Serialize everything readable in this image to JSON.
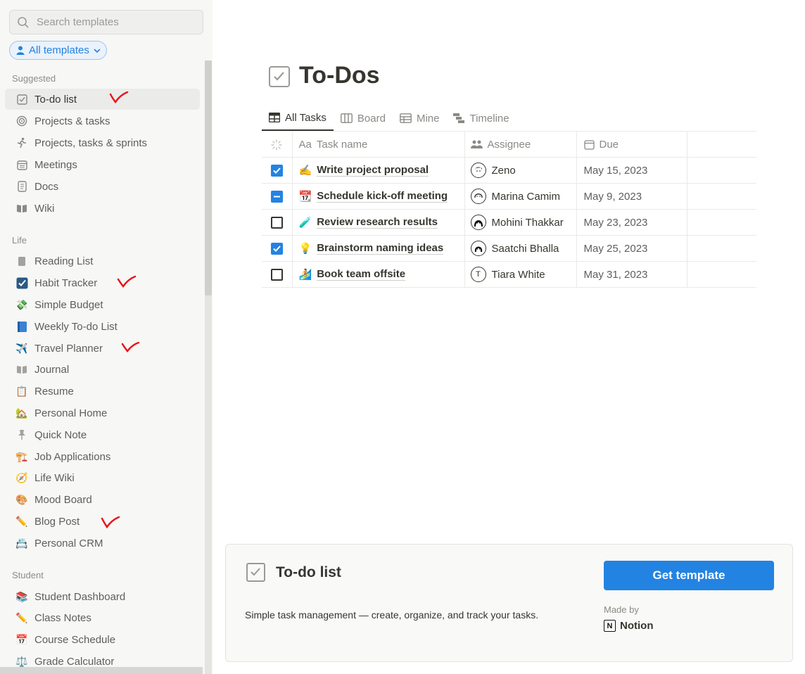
{
  "sidebar": {
    "search_placeholder": "Search templates",
    "filter_label": "All templates",
    "sections": {
      "suggested": "Suggested",
      "life": "Life",
      "student": "Student"
    },
    "suggested_items": [
      {
        "label": "To-do list",
        "icon": "checkbox-icon",
        "selected": true
      },
      {
        "label": "Projects & tasks",
        "icon": "target-icon"
      },
      {
        "label": "Projects, tasks & sprints",
        "icon": "runner-icon"
      },
      {
        "label": "Meetings",
        "icon": "calendar-icon"
      },
      {
        "label": "Docs",
        "icon": "document-icon"
      },
      {
        "label": "Wiki",
        "icon": "book-icon"
      }
    ],
    "life_items": [
      {
        "label": "Reading List",
        "icon": "bookmark-icon"
      },
      {
        "label": "Habit Tracker",
        "icon": "checked-box-icon"
      },
      {
        "label": "Simple Budget",
        "icon": "money-icon"
      },
      {
        "label": "Weekly To-do List",
        "icon": "blue-book-icon"
      },
      {
        "label": "Travel Planner",
        "icon": "airplane-icon"
      },
      {
        "label": "Journal",
        "icon": "book-icon"
      },
      {
        "label": "Resume",
        "icon": "clipboard-icon"
      },
      {
        "label": "Personal Home",
        "icon": "house-icon"
      },
      {
        "label": "Quick Note",
        "icon": "pushpin-icon"
      },
      {
        "label": "Job Applications",
        "icon": "crane-icon"
      },
      {
        "label": "Life Wiki",
        "icon": "compass-icon"
      },
      {
        "label": "Mood Board",
        "icon": "palette-icon"
      },
      {
        "label": "Blog Post",
        "icon": "pencil-icon"
      },
      {
        "label": "Personal CRM",
        "icon": "card-index-icon"
      }
    ],
    "student_items": [
      {
        "label": "Student Dashboard",
        "icon": "books-icon"
      },
      {
        "label": "Class Notes",
        "icon": "pencil-icon"
      },
      {
        "label": "Course Schedule",
        "icon": "calendar-icon"
      },
      {
        "label": "Grade Calculator",
        "icon": "scales-icon"
      }
    ]
  },
  "preview": {
    "title": "To-Dos",
    "views": [
      "All Tasks",
      "Board",
      "Mine",
      "Timeline"
    ],
    "columns": {
      "task": "Task name",
      "assignee": "Assignee",
      "due": "Due"
    },
    "rows": [
      {
        "done": "checked",
        "emoji": "✍️",
        "task": "Write project proposal",
        "assignee": "Zeno",
        "due": "May 15, 2023"
      },
      {
        "done": "partial",
        "emoji": "📆",
        "task": "Schedule kick-off meeting",
        "assignee": "Marina Camim",
        "due": "May 9, 2023"
      },
      {
        "done": "unchecked",
        "emoji": "🧪",
        "task": "Review research results",
        "assignee": "Mohini Thakkar",
        "due": "May 23, 2023"
      },
      {
        "done": "checked",
        "emoji": "💡",
        "task": "Brainstorm naming ideas",
        "assignee": "Saatchi Bhalla",
        "due": "May 25, 2023"
      },
      {
        "done": "unchecked",
        "emoji": "🏄",
        "task": "Book team offsite",
        "assignee": "Tiara White",
        "due": "May 31, 2023"
      }
    ]
  },
  "card": {
    "title": "To-do list",
    "description": "Simple task management — create, organize, and track your tasks.",
    "button": "Get template",
    "made_by_label": "Made by",
    "creator": "Notion",
    "creator_logo_letter": "N",
    "avatar_initial_tiara": "T"
  },
  "colors": {
    "accent": "#2383e2",
    "annotation_mark": "#e8141a"
  }
}
